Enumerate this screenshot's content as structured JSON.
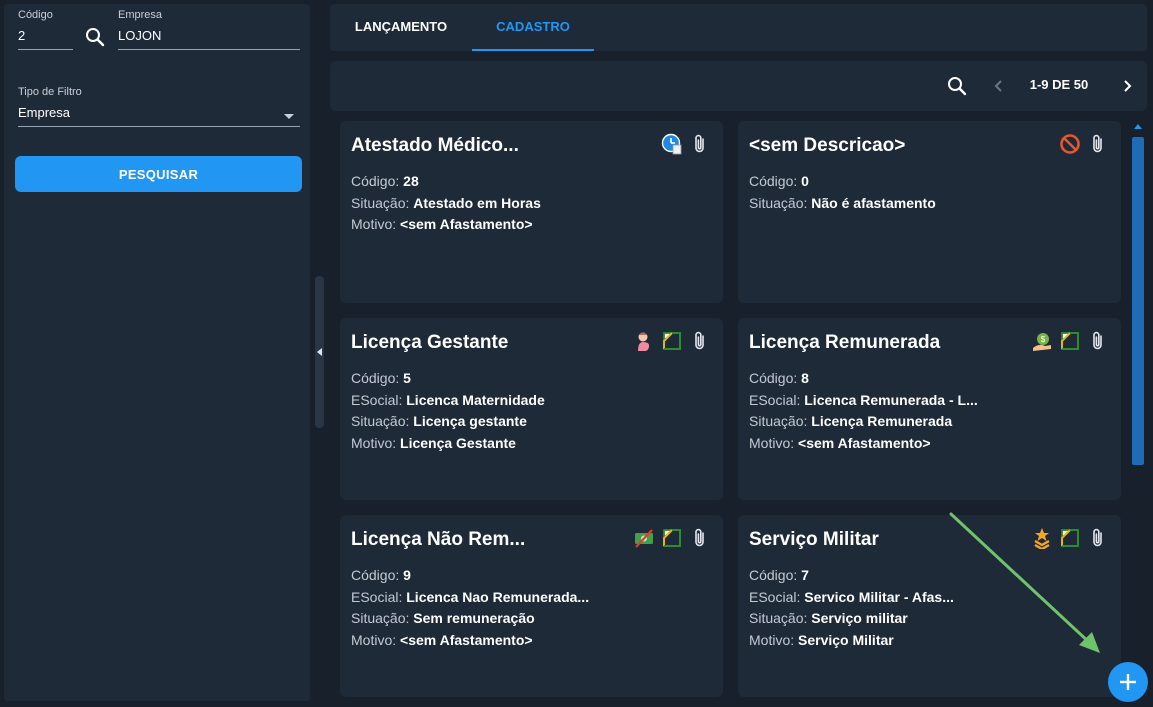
{
  "filters": {
    "codigo": {
      "label": "Código",
      "value": "2"
    },
    "empresa": {
      "label": "Empresa",
      "value": "LOJON"
    },
    "tipo": {
      "label": "Tipo de Filtro",
      "value": "Empresa"
    },
    "search_button": "PESQUISAR"
  },
  "tabs": [
    {
      "label": "LANÇAMENTO",
      "active": false
    },
    {
      "label": "CADASTRO",
      "active": true
    }
  ],
  "toolbar": {
    "range": "1-9 DE 50"
  },
  "colors": {
    "accent": "#2196f3",
    "panel": "#1f2a38",
    "background": "#17202b",
    "arrow": "#6fc36a"
  },
  "cards": [
    {
      "title": "Atestado Médico...",
      "icons": [
        "clock-document-icon",
        "paperclip-icon"
      ],
      "lines": [
        {
          "label": "Código: ",
          "value": "28"
        },
        {
          "label": "Situação: ",
          "value": "Atestado em Horas"
        },
        {
          "label": "Motivo: ",
          "value": "<sem Afastamento>"
        }
      ]
    },
    {
      "title": "<sem Descricao>",
      "icons": [
        "prohibited-icon",
        "paperclip-icon"
      ],
      "lines": [
        {
          "label": "Código: ",
          "value": "0"
        },
        {
          "label": "Situação: ",
          "value": "Não é afastamento"
        }
      ]
    },
    {
      "title": "Licença Gestante",
      "icons": [
        "pregnant-woman-icon",
        "esocial-icon",
        "paperclip-icon"
      ],
      "lines": [
        {
          "label": "Código: ",
          "value": "5"
        },
        {
          "label": "ESocial: ",
          "value": "Licenca Maternidade"
        },
        {
          "label": "Situação: ",
          "value": "Licença gestante"
        },
        {
          "label": "Motivo: ",
          "value": "Licença Gestante"
        }
      ]
    },
    {
      "title": "Licença Remunerada",
      "icons": [
        "money-bag-hand-icon",
        "esocial-icon",
        "paperclip-icon"
      ],
      "lines": [
        {
          "label": "Código: ",
          "value": "8"
        },
        {
          "label": "ESocial: ",
          "value": "Licenca Remunerada - L..."
        },
        {
          "label": "Situação: ",
          "value": "Licença Remunerada"
        },
        {
          "label": "Motivo: ",
          "value": "<sem Afastamento>"
        }
      ]
    },
    {
      "title": "Licença Não Rem...",
      "icons": [
        "no-money-icon",
        "esocial-icon",
        "paperclip-icon"
      ],
      "lines": [
        {
          "label": "Código: ",
          "value": "9"
        },
        {
          "label": "ESocial: ",
          "value": "Licenca Nao Remunerada..."
        },
        {
          "label": "Situação: ",
          "value": "Sem remuneração"
        },
        {
          "label": "Motivo: ",
          "value": "<sem Afastamento>"
        }
      ]
    },
    {
      "title": "Serviço Militar",
      "icons": [
        "military-rank-icon",
        "esocial-icon",
        "paperclip-icon"
      ],
      "lines": [
        {
          "label": "Código: ",
          "value": "7"
        },
        {
          "label": "ESocial: ",
          "value": "Servico Militar - Afas..."
        },
        {
          "label": "Situação: ",
          "value": "Serviço militar"
        },
        {
          "label": "Motivo: ",
          "value": "Serviço Militar"
        }
      ]
    }
  ]
}
